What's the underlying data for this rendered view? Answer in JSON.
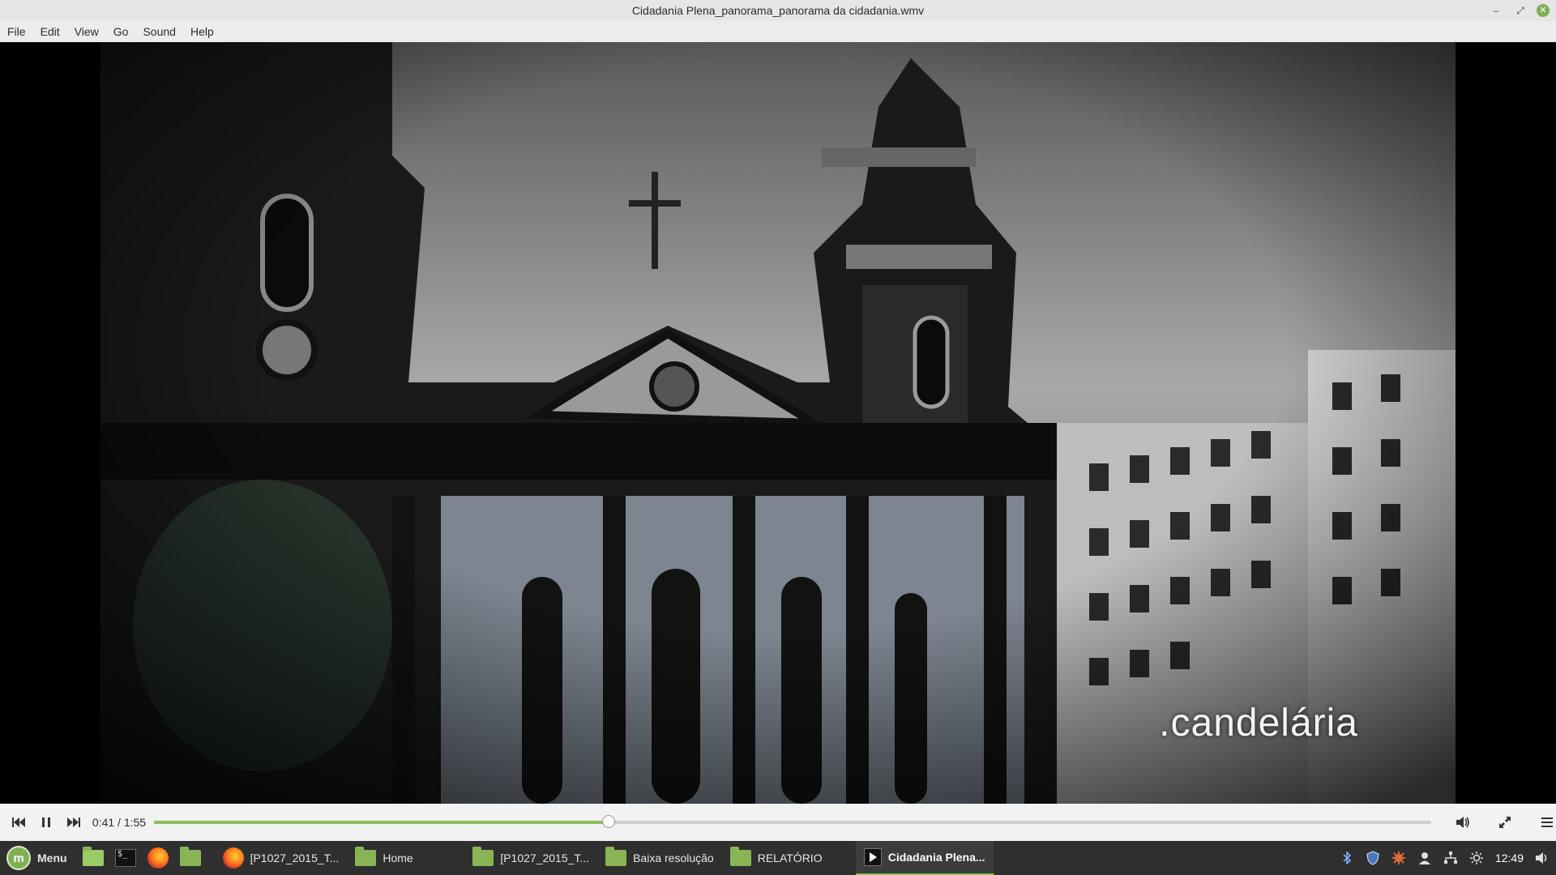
{
  "window": {
    "title": "Cidadania Plena_panorama_panorama da cidadania.wmv",
    "controls": {
      "minimize": "–",
      "restore": "⤢",
      "close": "✕"
    }
  },
  "menubar": {
    "items": [
      "File",
      "Edit",
      "View",
      "Go",
      "Sound",
      "Help"
    ]
  },
  "video": {
    "caption": ".candelária"
  },
  "player": {
    "time": "0:41 / 1:55",
    "progress_fraction": 0.356,
    "accent": "#8cbf57",
    "icons": [
      "skip-back-icon",
      "pause-icon",
      "skip-forward-icon",
      "volume-icon",
      "fullscreen-icon",
      "hamburger-menu-icon"
    ]
  },
  "taskbar": {
    "menu_label": "Menu",
    "tasks": [
      {
        "label": "[P1027_2015_T...",
        "icon": "firefox-icon"
      },
      {
        "label": "Home",
        "icon": "folder-icon"
      },
      {
        "label": "[P1027_2015_T...",
        "icon": "folder-icon"
      },
      {
        "label": "Baixa resolução",
        "icon": "folder-icon"
      },
      {
        "label": "RELATÓRIO",
        "icon": "folder-icon"
      },
      {
        "label": "Cidadania Plena...",
        "icon": "video-player-icon",
        "active": true
      }
    ],
    "clock": "12:49"
  }
}
